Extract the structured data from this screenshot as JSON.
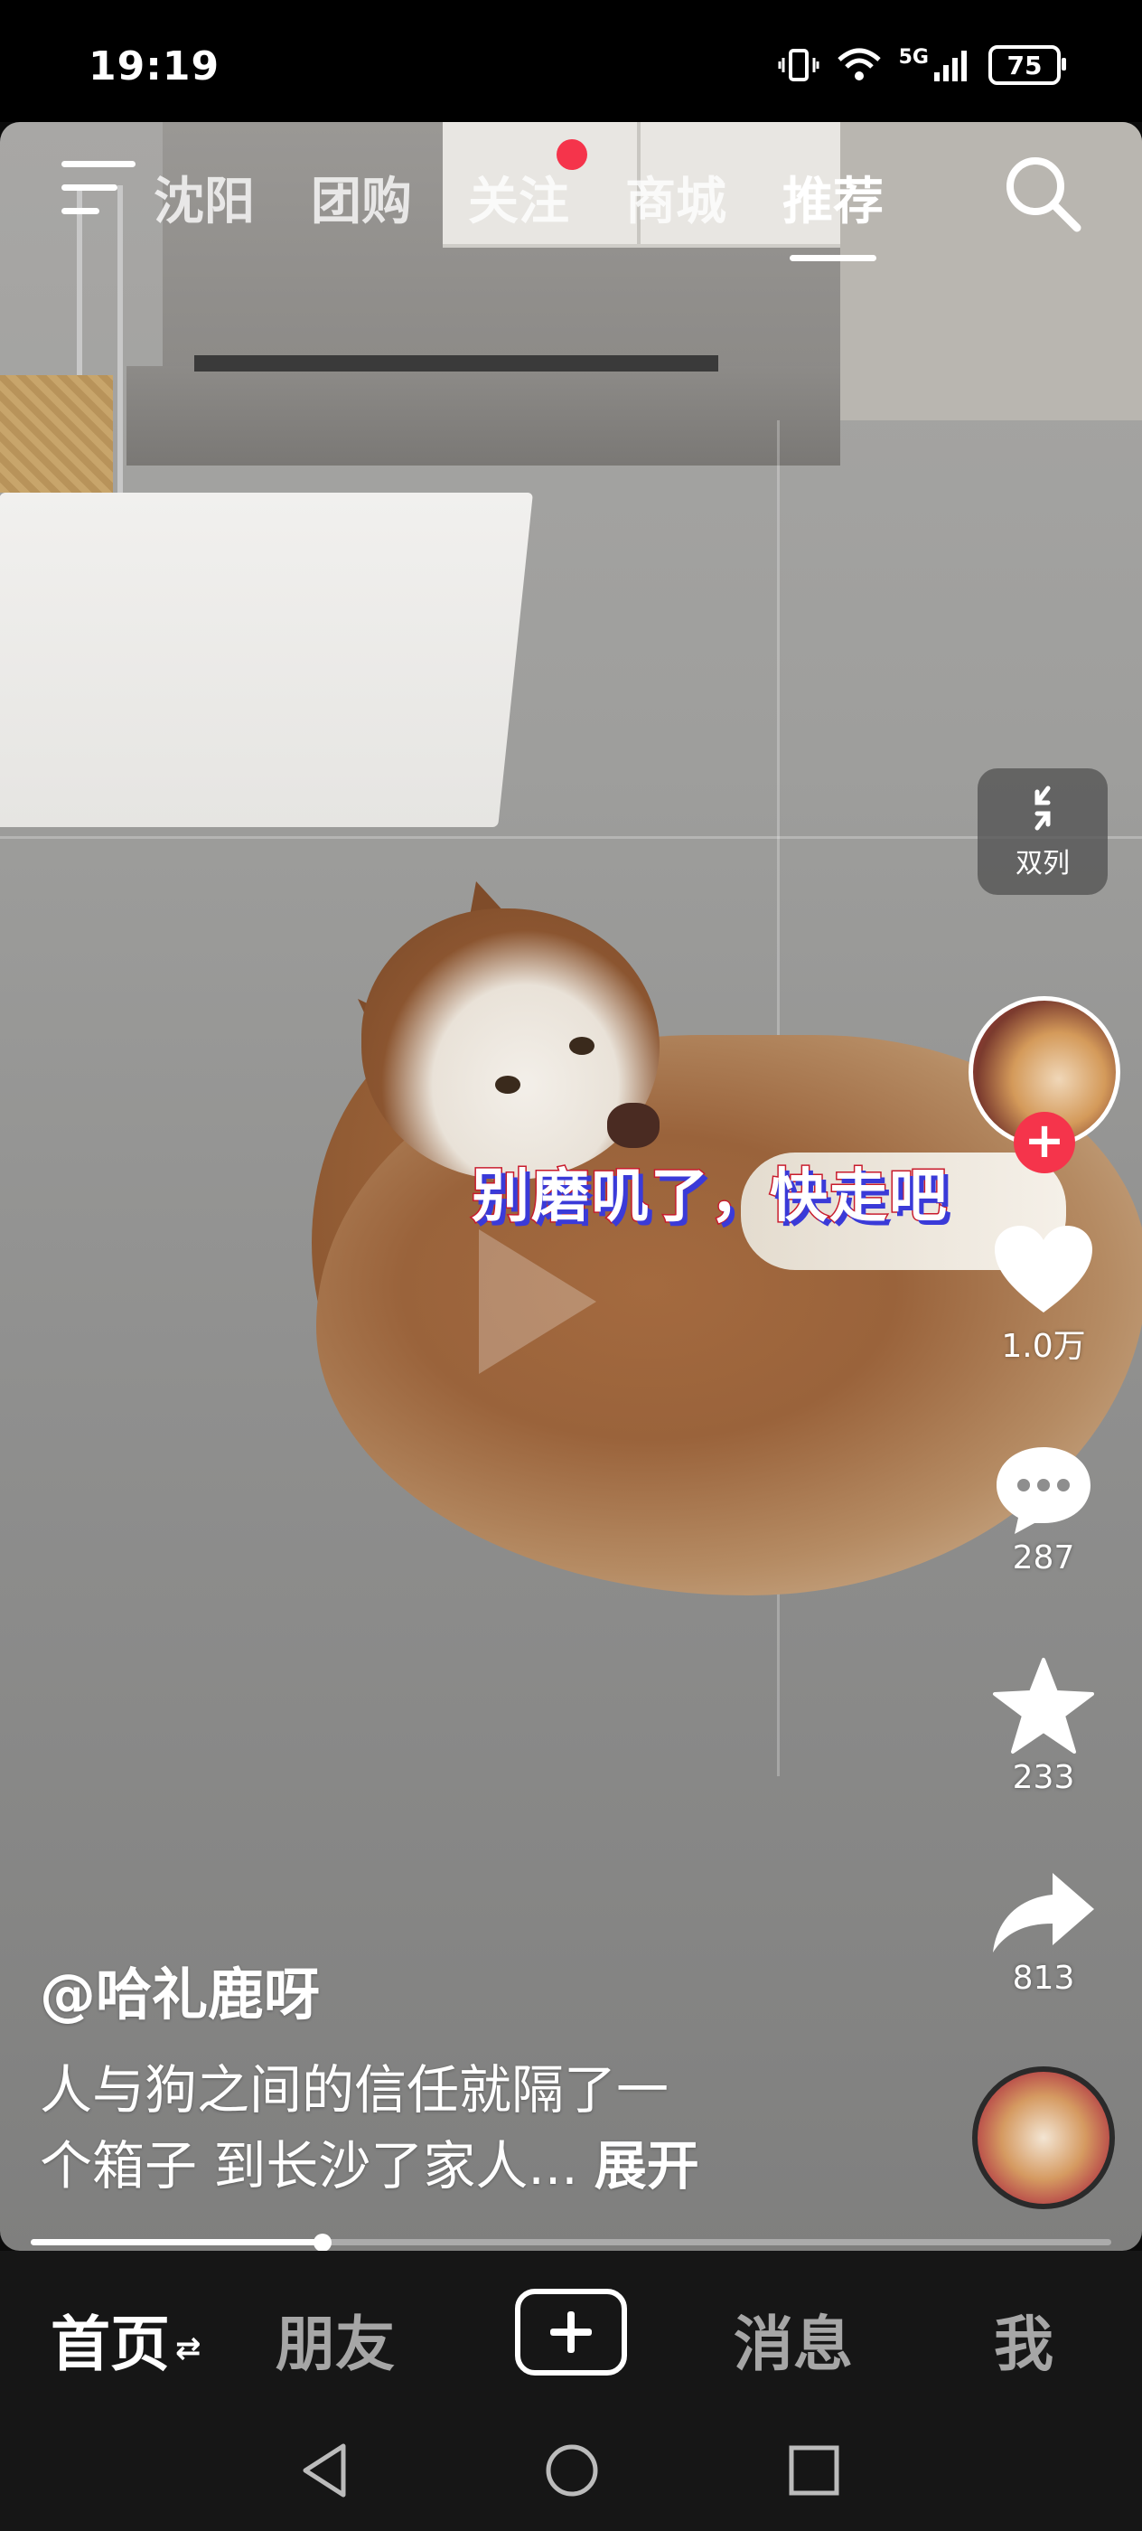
{
  "status_bar": {
    "time": "19:19",
    "network": "5G",
    "battery": "75"
  },
  "top_nav": {
    "tabs": [
      {
        "label": "沈阳",
        "active": false
      },
      {
        "label": "团购",
        "active": false
      },
      {
        "label": "关注",
        "active": false,
        "has_dot": true
      },
      {
        "label": "商城",
        "active": false
      },
      {
        "label": "推荐",
        "active": true
      }
    ]
  },
  "video": {
    "caption": "别磨叽了，快走吧",
    "dual_column_label": "双列",
    "author": "@哈礼鹿呀",
    "description_line1": "人与狗之间的信任就隔了一",
    "description_line2": "个箱子 到长沙了家人...",
    "expand_label": "展开",
    "progress": 0.27
  },
  "actions": {
    "likes": "1.0万",
    "comments": "287",
    "favorites": "233",
    "shares": "813"
  },
  "bottom_nav": {
    "home": "首页",
    "friends": "朋友",
    "messages": "消息",
    "me": "我"
  },
  "colors": {
    "accent": "#f5344b",
    "caption_stroke": "#c81b2c",
    "caption_shadow": "#3a3ad8"
  }
}
